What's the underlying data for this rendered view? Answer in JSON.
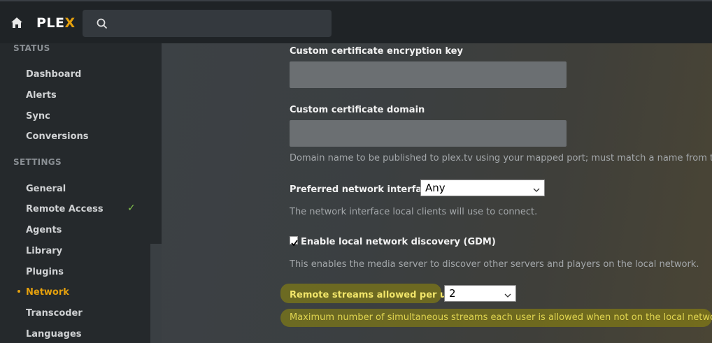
{
  "topbar": {
    "logo_main": "PLE",
    "logo_x": "X",
    "search_placeholder": ""
  },
  "sidebar": {
    "status_header": "STATUS",
    "status_items": [
      {
        "label": "Dashboard"
      },
      {
        "label": "Alerts"
      },
      {
        "label": "Sync"
      },
      {
        "label": "Conversions"
      }
    ],
    "settings_header": "SETTINGS",
    "settings_items": [
      {
        "label": "General"
      },
      {
        "label": "Remote Access",
        "checked": true
      },
      {
        "label": "Agents"
      },
      {
        "label": "Library"
      },
      {
        "label": "Plugins"
      },
      {
        "label": "Network",
        "active": true
      },
      {
        "label": "Transcoder"
      },
      {
        "label": "Languages"
      }
    ],
    "check_mark": "✓"
  },
  "settings": {
    "cert_key": {
      "label": "Custom certificate encryption key",
      "value": ""
    },
    "cert_domain": {
      "label": "Custom certificate domain",
      "value": "",
      "description": "Domain name to be published to plex.tv using your mapped port; must match a name from the cu"
    },
    "network_interface": {
      "label": "Preferred network interface",
      "value": "Any",
      "description": "The network interface local clients will use to connect."
    },
    "gdm": {
      "label": "Enable local network discovery (GDM)",
      "checked": true,
      "description": "This enables the media server to discover other servers and players on the local network."
    },
    "remote_streams": {
      "label": "Remote streams allowed per user",
      "value": "2",
      "description": "Maximum number of simultaneous streams each user is allowed when not on the local network."
    }
  },
  "colors": {
    "accent": "#e5a00d",
    "check_green": "#82c24c",
    "highlight": "#968c0a"
  }
}
